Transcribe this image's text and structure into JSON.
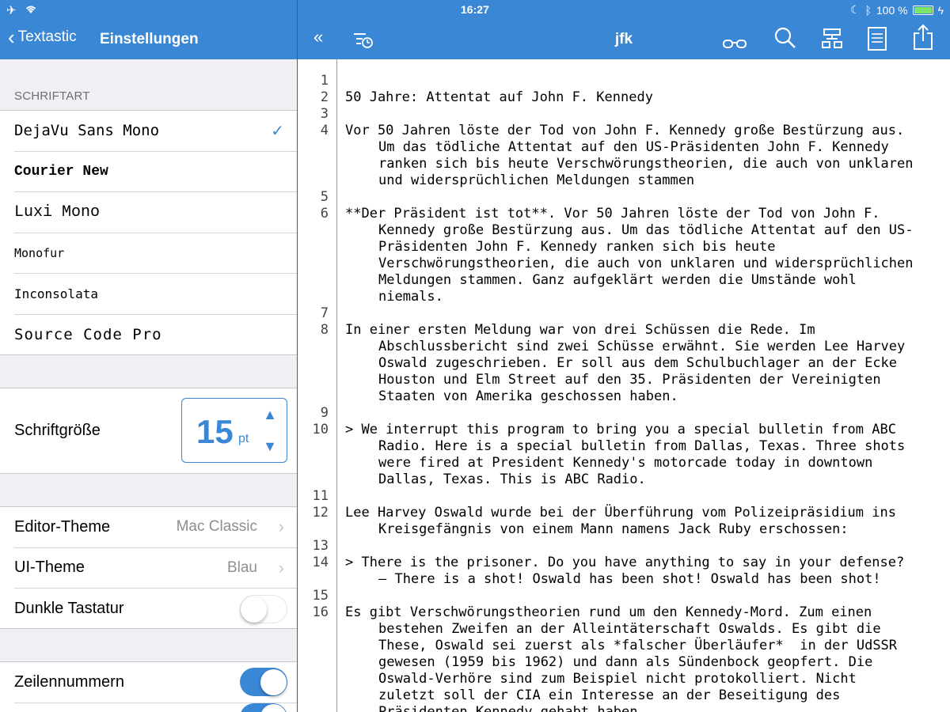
{
  "status": {
    "time": "16:27",
    "battery": "100 %"
  },
  "settings": {
    "back_label": "Textastic",
    "title": "Einstellungen",
    "font_section": "SCHRIFTART",
    "fonts": [
      {
        "label": "DejaVu Sans Mono",
        "selected": true
      },
      {
        "label": "Courier New",
        "selected": false
      },
      {
        "label": "Luxi Mono",
        "selected": false
      },
      {
        "label": "Monofur",
        "selected": false
      },
      {
        "label": "Inconsolata",
        "selected": false
      },
      {
        "label": "Source Code Pro",
        "selected": false
      }
    ],
    "font_size_label": "Schriftgröße",
    "font_size_value": "15",
    "font_size_unit": "pt",
    "editor_theme_label": "Editor-Theme",
    "editor_theme_value": "Mac Classic",
    "ui_theme_label": "UI-Theme",
    "ui_theme_value": "Blau",
    "dark_keyboard_label": "Dunkle Tastatur",
    "dark_keyboard_on": false,
    "line_numbers_label": "Zeilennummern",
    "line_numbers_on": true
  },
  "editor": {
    "title": "jfk",
    "lines": [
      {
        "n": "1",
        "text": [
          ""
        ]
      },
      {
        "n": "2",
        "text": [
          "50 Jahre: Attentat auf John F. Kennedy"
        ]
      },
      {
        "n": "3",
        "text": [
          ""
        ]
      },
      {
        "n": "4",
        "text": [
          "Vor 50 Jahren löste der Tod von John F. Kennedy große Bestürzung aus.",
          "Um das tödliche Attentat auf den US-Präsidenten John F. Kennedy",
          "ranken sich bis heute Verschwörungstheorien, die auch von unklaren",
          "und widersprüchlichen Meldungen stammen"
        ]
      },
      {
        "n": "5",
        "text": [
          ""
        ]
      },
      {
        "n": "6",
        "text": [
          "**Der Präsident ist tot**. Vor 50 Jahren löste der Tod von John F.",
          "Kennedy große Bestürzung aus. Um das tödliche Attentat auf den US-",
          "Präsidenten John F. Kennedy ranken sich bis heute",
          "Verschwörungstheorien, die auch von unklaren und widersprüchlichen",
          "Meldungen stammen. Ganz aufgeklärt werden die Umstände wohl",
          "niemals."
        ]
      },
      {
        "n": "7",
        "text": [
          ""
        ]
      },
      {
        "n": "8",
        "text": [
          "In einer ersten Meldung war von drei Schüssen die Rede. Im",
          "Abschlussbericht sind zwei Schüsse erwähnt. Sie werden Lee Harvey",
          "Oswald zugeschrieben. Er soll aus dem Schulbuchlager an der Ecke",
          "Houston und Elm Street auf den 35. Präsidenten der Vereinigten",
          "Staaten von Amerika geschossen haben."
        ]
      },
      {
        "n": "9",
        "text": [
          ""
        ]
      },
      {
        "n": "10",
        "text": [
          "> We interrupt this program to bring you a special bulletin from ABC",
          "Radio. Here is a special bulletin from Dallas, Texas. Three shots",
          "were fired at President Kennedy's motorcade today in downtown",
          "Dallas, Texas. This is ABC Radio."
        ]
      },
      {
        "n": "11",
        "text": [
          ""
        ]
      },
      {
        "n": "12",
        "text": [
          "Lee Harvey Oswald wurde bei der Überführung vom Polizeipräsidium ins",
          "Kreisgefängnis von einem Mann namens Jack Ruby erschossen:"
        ]
      },
      {
        "n": "13",
        "text": [
          ""
        ]
      },
      {
        "n": "14",
        "text": [
          "> There is the prisoner. Do you have anything to say in your defense?",
          "– There is a shot! Oswald has been shot! Oswald has been shot!"
        ]
      },
      {
        "n": "15",
        "text": [
          ""
        ]
      },
      {
        "n": "16",
        "text": [
          "Es gibt Verschwörungstheorien rund um den Kennedy-Mord. Zum einen",
          "bestehen Zweifen an der Alleintäterschaft Oswalds. Es gibt die",
          "These, Oswald sei zuerst als *falscher Überläufer*  in der UdSSR",
          "gewesen (1959 bis 1962) und dann als Sündenbock geopfert. Die",
          "Oswald-Verhöre sind zum Beispiel nicht protokolliert. Nicht",
          "zuletzt soll der CIA ein Interesse an der Beseitigung des",
          "Präsidenten Kennedy gehabt haben"
        ]
      }
    ]
  },
  "icons": [
    "airplane-icon",
    "wifi-icon",
    "back-chevron-icon",
    "checkmark-icon",
    "stepper-up-icon",
    "stepper-down-icon",
    "chevron-right-icon",
    "collapse-sidebar-icon",
    "recent-files-icon",
    "glasses-icon",
    "search-icon",
    "symbols-icon",
    "document-icon",
    "share-icon",
    "moon-icon",
    "bluetooth-icon",
    "battery-icon"
  ],
  "colors": {
    "accent": "#3a87d6",
    "background": "#efeff4"
  }
}
